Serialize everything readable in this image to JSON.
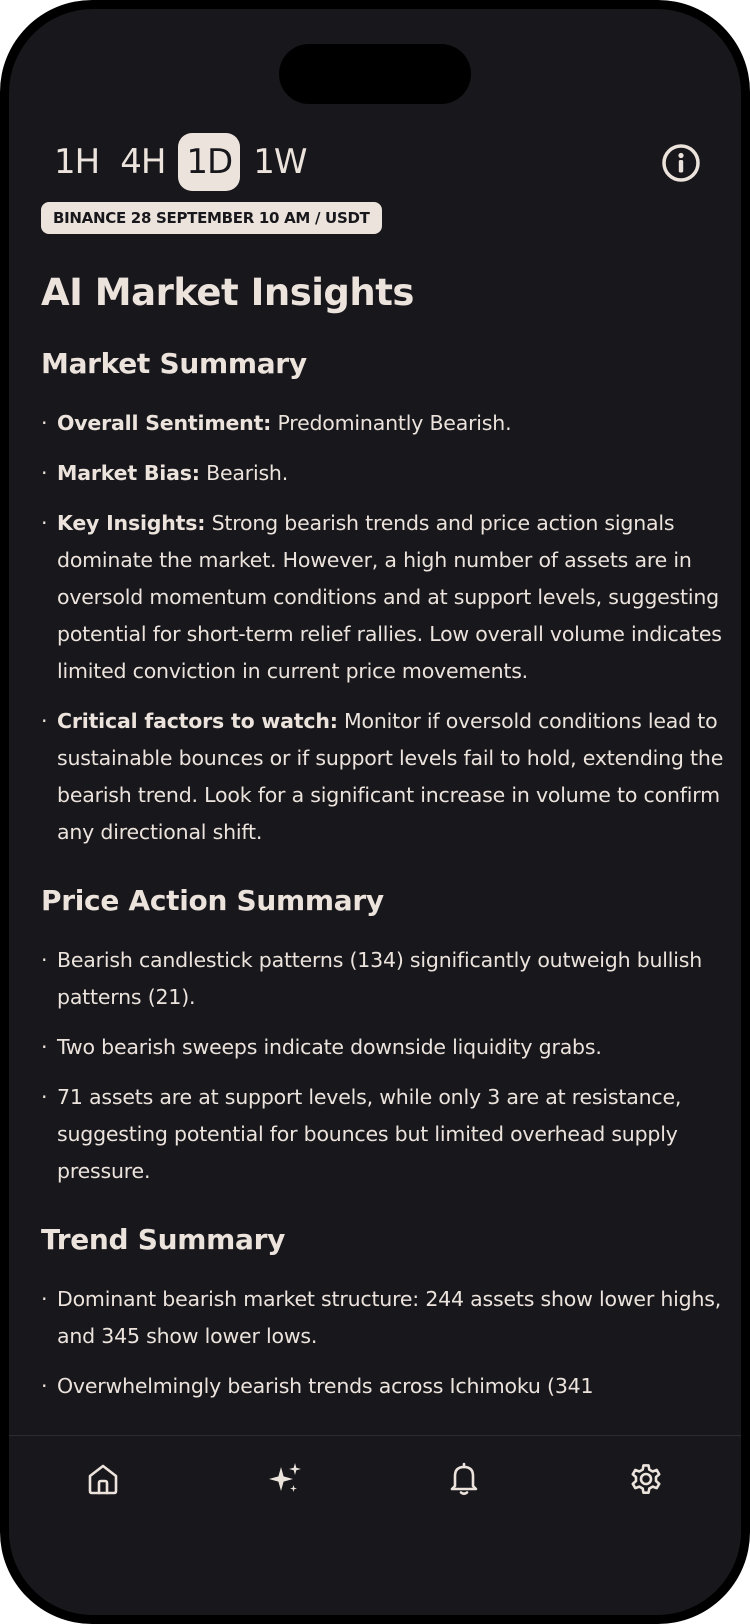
{
  "timeframes": {
    "items": [
      "1H",
      "4H",
      "1D",
      "1W"
    ],
    "active": "1D"
  },
  "badge": "BINANCE 28 SEPTEMBER 10 AM /  USDT",
  "page_title": "AI Market Insights",
  "market_summary": {
    "heading": "Market Summary",
    "items": [
      {
        "label": "Overall Sentiment:",
        "text": " Predominantly Bearish."
      },
      {
        "label": "Market Bias:",
        "text": " Bearish."
      },
      {
        "label": "Key Insights:",
        "text": " Strong bearish trends and price action signals dominate the market. However, a high number of assets are in oversold momentum conditions and at support levels, suggesting potential for short-term relief rallies. Low overall volume indicates limited conviction in current price movements."
      },
      {
        "label": "Critical factors to watch:",
        "text": " Monitor if oversold conditions lead to sustainable bounces or if support levels fail to hold, extending the bearish trend. Look for a significant increase in volume to confirm any directional shift."
      }
    ]
  },
  "price_action_summary": {
    "heading": "Price Action Summary",
    "items": [
      "Bearish candlestick patterns (134) significantly outweigh bullish patterns (21).",
      "Two bearish sweeps indicate downside liquidity grabs.",
      "71 assets are at support levels, while only 3 are at resistance, suggesting potential for bounces but limited overhead supply pressure."
    ]
  },
  "trend_summary": {
    "heading": "Trend Summary",
    "items": [
      "Dominant bearish market structure: 244 assets show lower highs, and 345 show lower lows.",
      "Overwhelmingly bearish trends across Ichimoku (341"
    ]
  },
  "tabbar": {
    "items": [
      "home-icon",
      "sparkles-icon",
      "bell-icon",
      "gear-icon"
    ],
    "active": "sparkles-icon"
  },
  "colors": {
    "background": "#17171c",
    "text": "#ece3dc",
    "accent_pill": "#ece3dc"
  }
}
